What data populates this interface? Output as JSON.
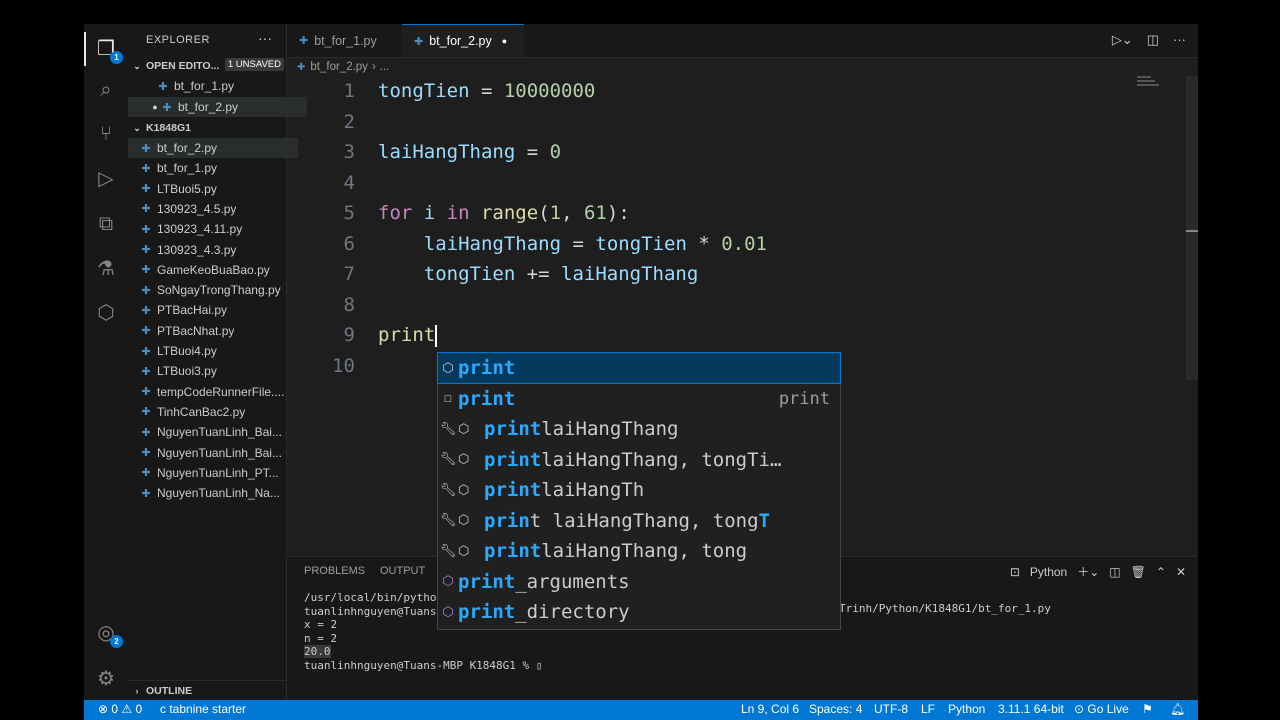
{
  "sidebar": {
    "title": "EXPLORER",
    "more": "···",
    "open_editors": {
      "label": "OPEN EDITO...",
      "badge": "1 UNSAVED",
      "files": [
        "bt_for_1.py",
        "bt_for_2.py"
      ]
    },
    "folder": {
      "label": "K1848G1",
      "files": [
        "bt_for_2.py",
        "bt_for_1.py",
        "LTBuoi5.py",
        "130923_4.5.py",
        "130923_4.11.py",
        "130923_4.3.py",
        "GameKeoBuaBao.py",
        "SoNgayTrongThang.py",
        "PTBacHai.py",
        "PTBacNhat.py",
        "LTBuoi4.py",
        "LTBuoi3.py",
        "tempCodeRunnerFile....",
        "TinhCanBac2.py",
        "NguyenTuanLinh_Bai...",
        "NguyenTuanLinh_Bai...",
        "NguyenTuanLinh_PT...",
        "NguyenTuanLinh_Na..."
      ]
    },
    "outline": "OUTLINE"
  },
  "activity": {
    "explorer_badge": "1",
    "account_badge": "2"
  },
  "tabs": [
    {
      "label": "bt_for_1.py"
    },
    {
      "label": "bt_for_2.py"
    }
  ],
  "breadcrumb": {
    "file": "bt_for_2.py",
    "more": "..."
  },
  "editor": {
    "line_numbers": [
      "1",
      "2",
      "3",
      "4",
      "5",
      "6",
      "7",
      "8",
      "9",
      "10"
    ],
    "l1": {
      "var": "tongTien",
      "op": " = ",
      "num": "10000000"
    },
    "l3": {
      "var": "laiHangThang",
      "op": " = ",
      "num": "0"
    },
    "l5": {
      "kw1": "for",
      "v": " i ",
      "kw2": "in",
      "fn": " range",
      "p1": "(",
      "a": "1",
      "c": ", ",
      "b": "61",
      "p2": "):"
    },
    "l6": {
      "var": "laiHangThang",
      "op": " = ",
      "var2": "tongTien",
      "op2": " * ",
      "num": "0.01"
    },
    "l7": {
      "var": "tongTien",
      "op": " += ",
      "var2": "laiHangThang"
    },
    "l9": {
      "fn": "print"
    }
  },
  "suggest": [
    {
      "match": "print",
      "rest": "",
      "detail": ""
    },
    {
      "match": "print",
      "rest": "",
      "detail": "print"
    },
    {
      "match": "print",
      "rest": " laiHangThang",
      "detail": ""
    },
    {
      "match": "print",
      "rest": " laiHangThang, tongTi…",
      "detail": ""
    },
    {
      "match": "print",
      "rest": " laiHangTh",
      "detail": ""
    },
    {
      "m1": "prin",
      "r1": "t laiHangThang, tong",
      "m2": "T"
    },
    {
      "match": "print",
      "rest": " laiHangThang, tong",
      "detail": ""
    },
    {
      "match": "print",
      "rest": "_arguments",
      "detail": ""
    },
    {
      "match": "print",
      "rest": "_directory",
      "detail": ""
    }
  ],
  "panel": {
    "tabs": [
      "PROBLEMS",
      "OUTPUT"
    ],
    "shell": "Python",
    "terminal": [
      "/usr/local/bin/python",
      "tuanlinhnguyen@Tuans-",
      "x = 2",
      "n = 2",
      "20.0",
      "tuanlinhnguyen@Tuans-MBP K1848G1 % "
    ],
    "terminal_right": "Trinh/Python/K1848G1/bt_for_1.py"
  },
  "status": {
    "errors": "0",
    "warnings": "0",
    "tabnine": "tabnine starter",
    "position": "Ln 9, Col 6",
    "spaces": "Spaces: 4",
    "encoding": "UTF-8",
    "eol": "LF",
    "language": "Python",
    "interpreter": "3.11.1 64-bit",
    "golive": "Go Live"
  },
  "colors": {
    "accent": "#0078d4",
    "status_bg": "#0078d4",
    "editor_bg": "#1e1e1e"
  }
}
